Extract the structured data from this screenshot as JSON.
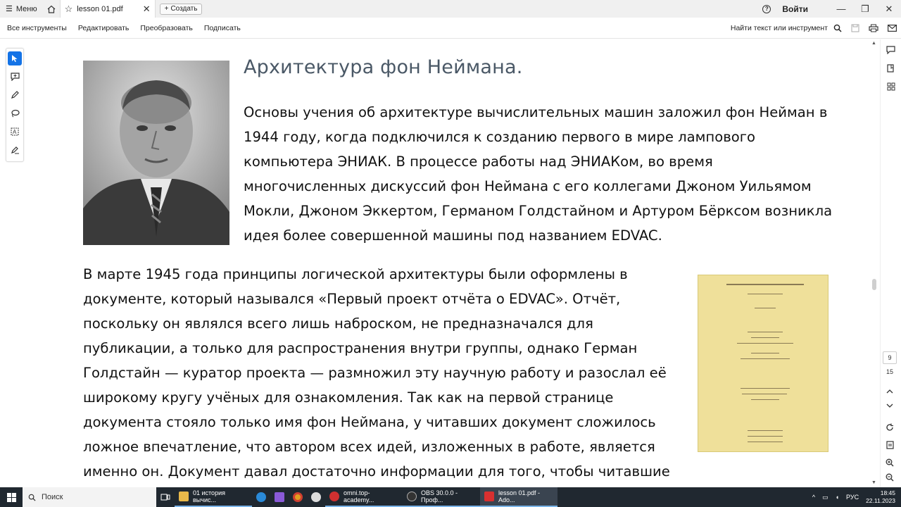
{
  "tabbar": {
    "menu_label": "Меню",
    "tab_title": "lesson 01.pdf",
    "create_label": "Создать",
    "signin_label": "Войти"
  },
  "toolbar": {
    "all_tools": "Все инструменты",
    "edit": "Редактировать",
    "convert": "Преобразовать",
    "sign": "Подписать",
    "find_placeholder": "Найти текст или инструмент"
  },
  "document": {
    "title": "Архитектура фон Неймана.",
    "para1": "Основы учения об архитектуре вычислительных машин заложил фон Нейман в 1944 году, когда подключился к созданию первого в мире лампового компьютера ЭНИАК. В процессе работы над ЭНИАКом, во время многочисленных дискуссий фон Неймана с его коллегами Джоном Уильямом Мокли, Джоном Эккертом, Германом Голдстайном и Артуром Бёрксом возникла идея более совершенной машины под названием EDVAC.",
    "para2": "В марте 1945 года принципы логической архитектуры были оформлены в документе, который назывался «Первый проект отчёта о EDVAC». Отчёт, поскольку он являлся всего лишь наброском, не предназначался для публикации, а только для распространения внутри группы, однако Герман Голдстайн — куратор проекта — размножил эту научную работу и разослал её широкому кругу учёных для ознакомления. Так как на первой странице документа стояло только имя фон Неймана, у читавших документ сложилось ложное впечатление, что автором всех идей, изложенных в работе, является именно он. Документ давал достаточно информации для того, чтобы читавшие"
  },
  "page_nav": {
    "current": "9",
    "total": "15"
  },
  "taskbar": {
    "search_label": "Поиск",
    "items": [
      "01 история вычис...",
      "omni.top-academy...",
      "OBS 30.0.0 - Проф...",
      "lesson 01.pdf - Ado..."
    ],
    "lang": "РУС",
    "time": "18:45",
    "date": "22.11.2023"
  },
  "colors": {
    "accent": "#1473e6",
    "title_color": "#4a5866",
    "taskbar_bg": "#202830"
  }
}
